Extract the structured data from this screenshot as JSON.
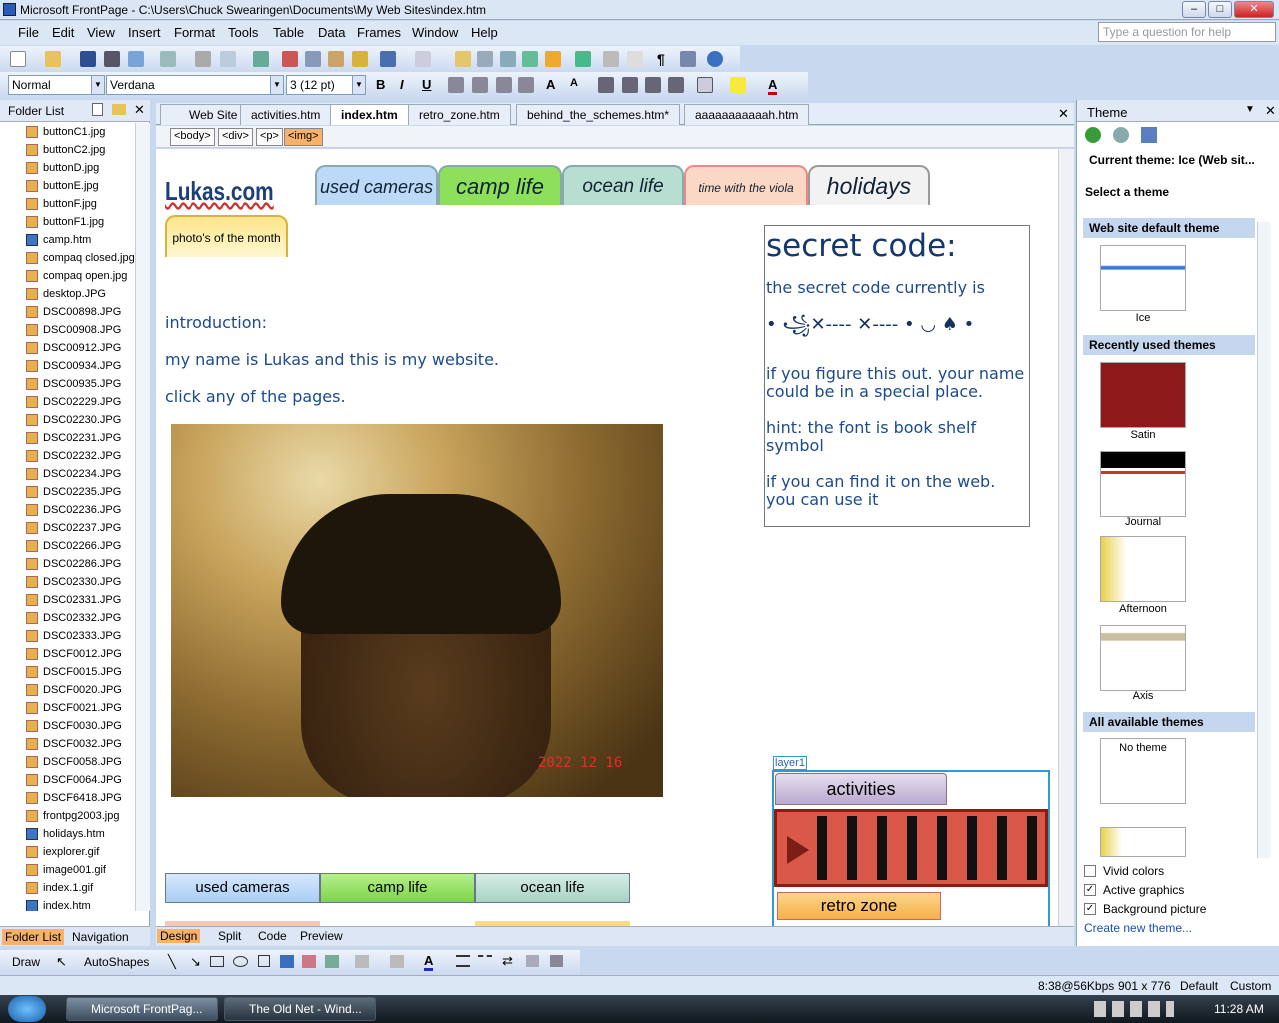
{
  "window": {
    "title": "Microsoft FrontPage - C:\\Users\\Chuck Swearingen\\Documents\\My Web Sites\\index.htm"
  },
  "menu": [
    "File",
    "Edit",
    "View",
    "Insert",
    "Format",
    "Tools",
    "Table",
    "Data",
    "Frames",
    "Window",
    "Help"
  ],
  "help_placeholder": "Type a question for help",
  "format": {
    "style": "Normal",
    "font": "Verdana",
    "size": "3 (12 pt)"
  },
  "folder_list": {
    "title": "Folder List",
    "files": [
      "buttonC1.jpg",
      "buttonC2.jpg",
      "buttonD.jpg",
      "buttonE.jpg",
      "buttonF.jpg",
      "buttonF1.jpg",
      "camp.htm",
      "compaq closed.jpg",
      "compaq open.jpg",
      "desktop.JPG",
      "DSC00898.JPG",
      "DSC00908.JPG",
      "DSC00912.JPG",
      "DSC00934.JPG",
      "DSC00935.JPG",
      "DSC02229.JPG",
      "DSC02230.JPG",
      "DSC02231.JPG",
      "DSC02232.JPG",
      "DSC02234.JPG",
      "DSC02235.JPG",
      "DSC02236.JPG",
      "DSC02237.JPG",
      "DSC02266.JPG",
      "DSC02286.JPG",
      "DSC02330.JPG",
      "DSC02331.JPG",
      "DSC02332.JPG",
      "DSC02333.JPG",
      "DSCF0012.JPG",
      "DSCF0015.JPG",
      "DSCF0020.JPG",
      "DSCF0021.JPG",
      "DSCF0030.JPG",
      "DSCF0032.JPG",
      "DSCF0058.JPG",
      "DSCF0064.JPG",
      "DSCF6418.JPG",
      "frontpg2003.jpg",
      "holidays.htm",
      "iexplorer.gif",
      "image001.gif",
      "index.1.gif",
      "index.htm"
    ],
    "tab_folder": "Folder List",
    "tab_nav": "Navigation"
  },
  "doc_tabs": [
    "Web Site",
    "activities.htm",
    "index.htm",
    "retro_zone.htm",
    "behind_the_schemes.htm*",
    "aaaaaaaaaaah.htm"
  ],
  "tags": [
    "<body>",
    "<div>",
    "<p>",
    "<img>"
  ],
  "page": {
    "logo": "Lukas.com",
    "nav_tabs": [
      "used cameras",
      "camp life",
      "ocean life",
      "time with the viola",
      "holidays"
    ],
    "photo_tab": "photo's of the month",
    "intro": [
      "introduction:",
      "my name is Lukas and this is my website.",
      "click any of the pages."
    ],
    "photo_date": "2022 12 16",
    "secret": {
      "title": "secret code:",
      "line1": "the secret code currently is",
      "code": "• ꧁✕---- ✕----  • ◡ ♠ •",
      "p1": "if you figure this out. your name could be in a special place.",
      "p2": "hint: the font is book shelf symbol",
      "p3": "if you can find it on the web. you can use it"
    },
    "bottom_buttons": [
      "used cameras",
      "camp life",
      "ocean life"
    ],
    "layer": {
      "label": "layer1",
      "btn1": "activities",
      "btn2": "retro zone"
    }
  },
  "views": [
    "Design",
    "Split",
    "Code",
    "Preview"
  ],
  "theme": {
    "title": "Theme",
    "current": "Current theme: Ice  (Web sit...",
    "select": "Select a theme",
    "default_hdr": "Web site default theme",
    "default_name": "Ice",
    "recent_hdr": "Recently used themes",
    "recent": [
      "Satin",
      "Journal",
      "Afternoon",
      "Axis"
    ],
    "all_hdr": "All available themes",
    "no_theme": "No theme",
    "opts": [
      {
        "label": "Vivid colors",
        "checked": false
      },
      {
        "label": "Active graphics",
        "checked": true
      },
      {
        "label": "Background picture",
        "checked": true
      }
    ],
    "create": "Create new theme..."
  },
  "draw": {
    "draw": "Draw",
    "autoshapes": "AutoShapes"
  },
  "status": {
    "speed": "8:38@56Kbps",
    "size": "901 x 776",
    "mode1": "Default",
    "mode2": "Custom"
  },
  "taskbar": {
    "items": [
      "Microsoft FrontPag...",
      "The Old Net - Wind..."
    ],
    "time": "11:28 AM"
  },
  "colors": {
    "accent": "#1c4a8c",
    "tab_green": "#8ee05c",
    "tab_blue": "#bcd9f7",
    "tab_teal": "#b8ddd1",
    "tab_peach": "#fbd8c6"
  }
}
